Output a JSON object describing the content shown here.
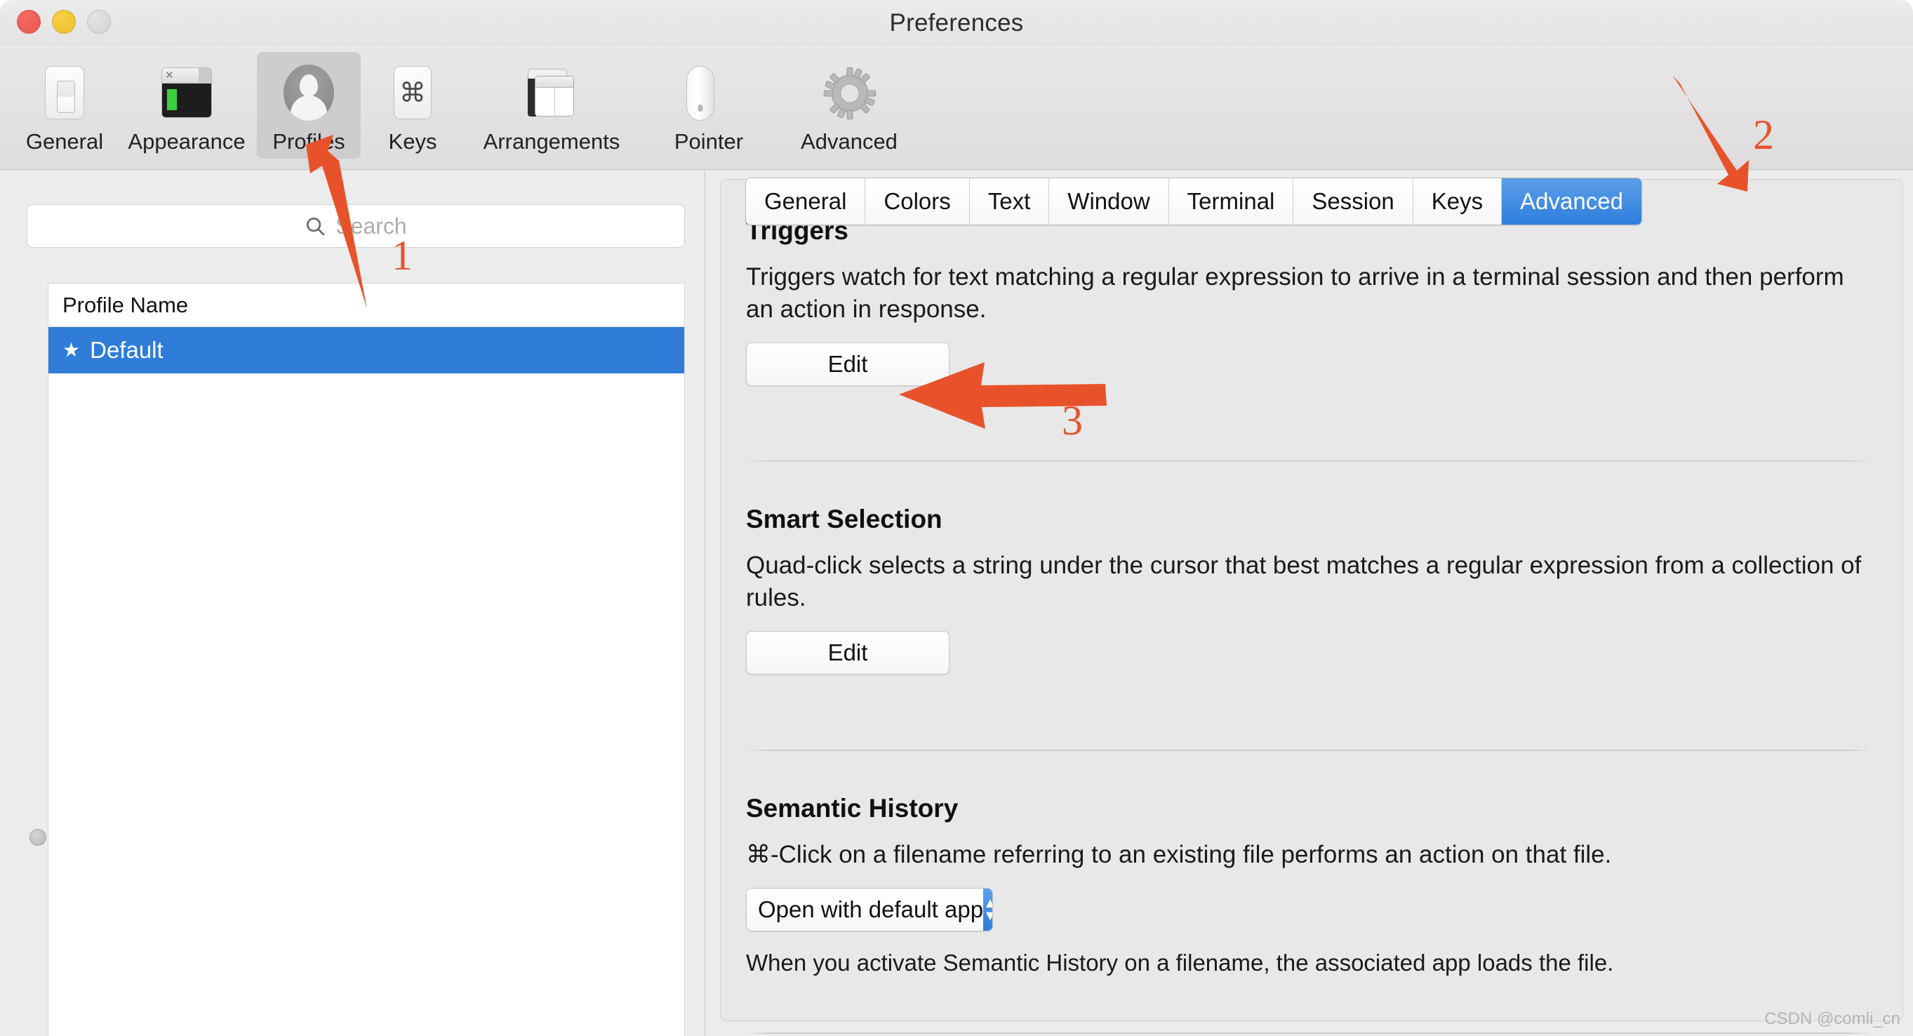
{
  "window": {
    "title": "Preferences",
    "traffic_lights": [
      {
        "name": "close",
        "color": "#e8564c"
      },
      {
        "name": "minimize",
        "color": "#eebe26"
      },
      {
        "name": "zoom",
        "color": "#d3d3d3"
      }
    ]
  },
  "toolbar": {
    "items": [
      {
        "label": "General",
        "icon": "general-icon",
        "selected": false
      },
      {
        "label": "Appearance",
        "icon": "appearance-icon",
        "selected": false
      },
      {
        "label": "Profiles",
        "icon": "profiles-icon",
        "selected": true
      },
      {
        "label": "Keys",
        "icon": "keys-icon",
        "selected": false
      },
      {
        "label": "Arrangements",
        "icon": "arrangements-icon",
        "selected": false
      },
      {
        "label": "Pointer",
        "icon": "pointer-icon",
        "selected": false
      },
      {
        "label": "Advanced",
        "icon": "gear-icon",
        "selected": false
      }
    ]
  },
  "sidebar": {
    "search": {
      "placeholder": "Search",
      "value": "",
      "icon": "search-icon"
    },
    "table": {
      "column_header": "Profile Name",
      "rows": [
        {
          "star": "★",
          "name": "Default",
          "selected": true
        }
      ]
    }
  },
  "tabs": [
    {
      "label": "General",
      "selected": false
    },
    {
      "label": "Colors",
      "selected": false
    },
    {
      "label": "Text",
      "selected": false
    },
    {
      "label": "Window",
      "selected": false
    },
    {
      "label": "Terminal",
      "selected": false
    },
    {
      "label": "Session",
      "selected": false
    },
    {
      "label": "Keys",
      "selected": false
    },
    {
      "label": "Advanced",
      "selected": true
    }
  ],
  "sections": {
    "triggers": {
      "title": "Triggers",
      "body": "Triggers watch for text matching a regular expression to arrive in a terminal session and then perform an action in response.",
      "button": "Edit"
    },
    "smart_selection": {
      "title": "Smart Selection",
      "body": "Quad-click selects a string under the cursor that best matches a regular expression from a collection of rules.",
      "button": "Edit"
    },
    "semantic_history": {
      "title": "Semantic History",
      "body": "⌘-Click on a filename referring to an existing file performs an action on that file.",
      "select_value": "Open with default app",
      "note": "When you activate Semantic History on a filename, the associated app loads the file."
    }
  },
  "annotations": {
    "accent_color": "#e8522a",
    "markers": [
      {
        "number": "1",
        "target": "Profiles toolbar item"
      },
      {
        "number": "2",
        "target": "Advanced tab"
      },
      {
        "number": "3",
        "target": "Triggers Edit button"
      }
    ]
  },
  "watermark": "CSDN @comli_cn"
}
